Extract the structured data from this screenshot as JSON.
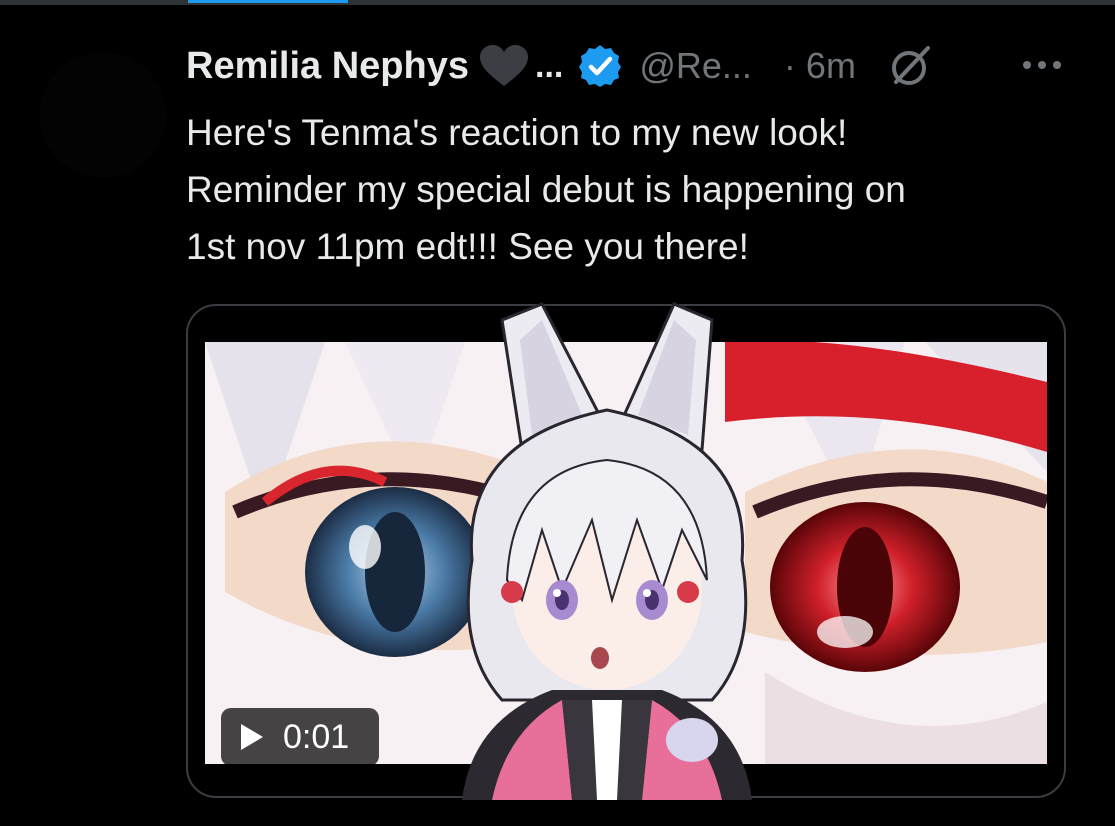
{
  "tweet": {
    "author_name": "Remilia Nephys",
    "name_truncation": "...",
    "handle": "@Re...",
    "separator": "·",
    "timestamp": "6m",
    "text_lines": [
      "Here's Tenma's reaction to my new look!",
      "Reminder my special debut is happening on",
      "1st nov 11pm edt!!! See you there!"
    ]
  },
  "video": {
    "duration": "0:01"
  },
  "colors": {
    "background": "#000000",
    "text_primary": "#e7e9ea",
    "text_secondary": "#71767b",
    "verified_blue": "#1d9bf0",
    "border": "#3a3d41"
  },
  "icons": {
    "heart": "black-heart-icon",
    "verified": "verified-badge-icon",
    "grok": "grok-icon",
    "more": "more-options-icon",
    "play": "play-icon"
  }
}
